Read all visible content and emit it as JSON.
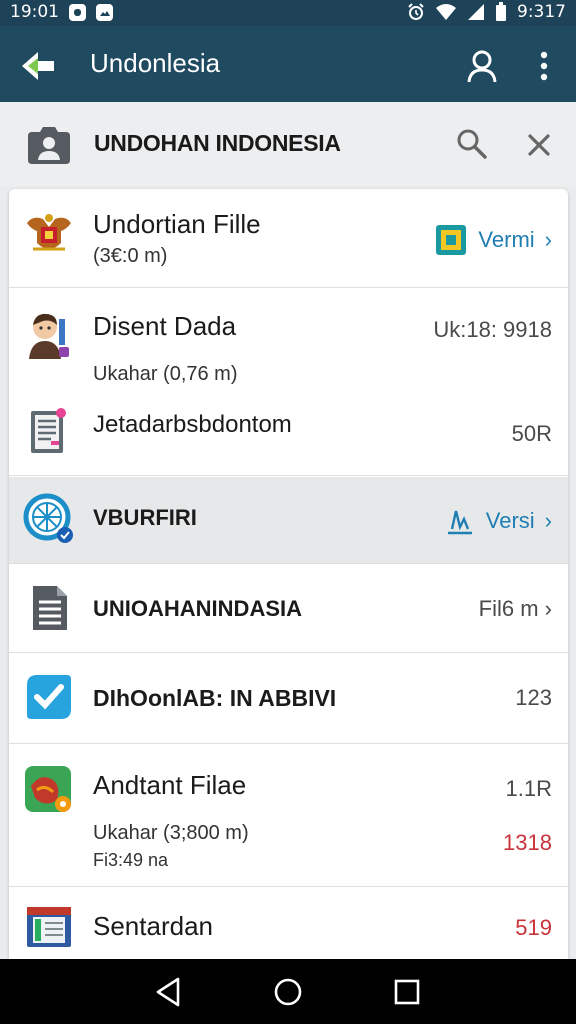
{
  "status_bar": {
    "time": "19:01",
    "battery_time": "9:317"
  },
  "app_bar": {
    "title": "Undonlesia"
  },
  "search": {
    "query": "UNDOHAN INDONESIA"
  },
  "rows": [
    {
      "icon": "garuda-emblem-icon",
      "title": "Undortian Fille",
      "subtitle": "(3€:0 m)",
      "right": "Vermi",
      "right_icon": "image-badge-icon"
    },
    {
      "icon": "person-avatar-icon",
      "title": "Disent Dada",
      "subtitle": "Ukahar (0,76 m)",
      "right": "Uk:18: 9918"
    },
    {
      "icon": "document-list-icon",
      "title": "Jetadarbsbdontom",
      "right": "50R"
    },
    {
      "icon": "globe-check-icon",
      "title": "VBURFIRI",
      "right": "Versi",
      "right_icon": "signature-icon"
    },
    {
      "icon": "spreadsheet-icon",
      "title": "UNIOAHANINDASIA",
      "right": "Fil6 m"
    },
    {
      "icon": "checkmark-shield-icon",
      "title": "DIhOonlAB: IN ABBIVI",
      "right": "123"
    },
    {
      "icon": "map-app-icon",
      "title": "Andtant Filae",
      "subtitle": "Ukahar (3;800 m)",
      "subtitle2": "Fi3:49 na",
      "right": "1.1R",
      "right2": "1318"
    },
    {
      "icon": "book-icon",
      "title": "Sentardan",
      "right": "519"
    }
  ]
}
